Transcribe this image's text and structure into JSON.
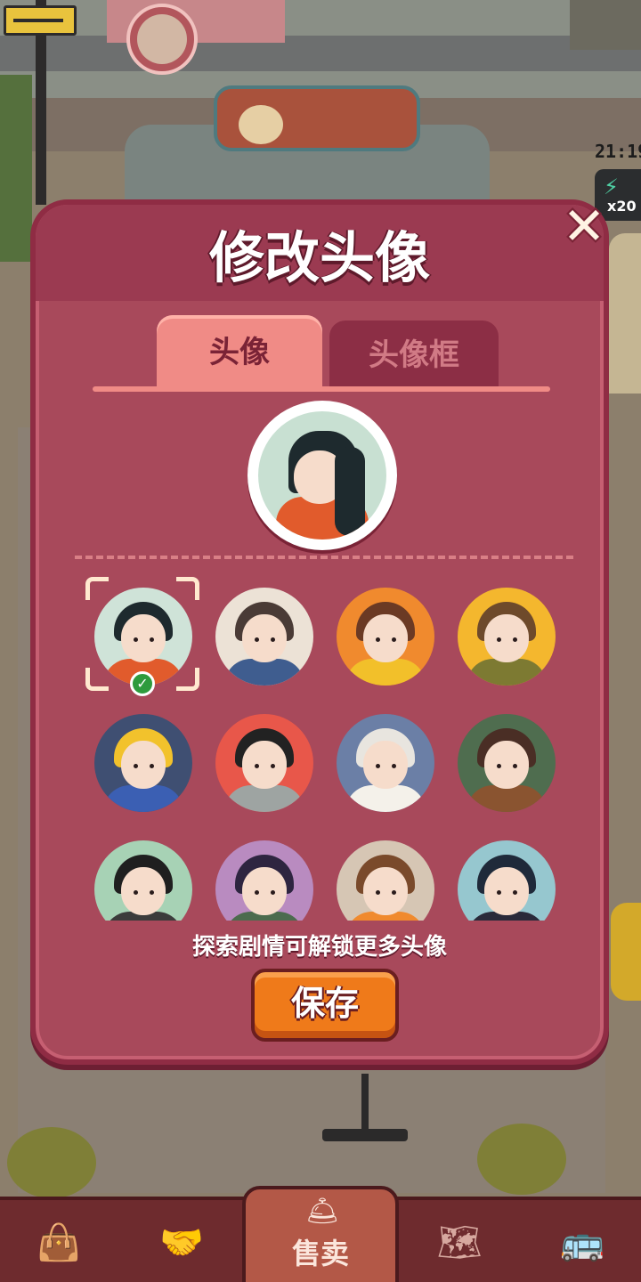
{
  "hud": {
    "clock": "21:19",
    "energy_count": "x20"
  },
  "modal": {
    "title": "修改头像",
    "close_glyph": "✕",
    "tabs": [
      {
        "label": "头像",
        "active": true
      },
      {
        "label": "头像框",
        "active": false
      }
    ],
    "hint": "探索剧情可解锁更多头像",
    "save_label": "保存"
  },
  "avatars": [
    {
      "name": "girl-braid",
      "hair": "#1e2a2e",
      "bg": "#cfe3d8",
      "body": "#e15b2c",
      "selected": true
    },
    {
      "name": "boy-glasses",
      "hair": "#4a3b36",
      "bg": "#ece2d6",
      "body": "#3f5d8f",
      "selected": false
    },
    {
      "name": "girl-brown-hair",
      "hair": "#6b3a24",
      "bg": "#f08a2e",
      "body": "#f2c02a",
      "selected": false
    },
    {
      "name": "girl-short-hair",
      "hair": "#6e4a2b",
      "bg": "#f4b72e",
      "body": "#7d7a32",
      "selected": false
    },
    {
      "name": "boy-hardhat",
      "hair": "#f2c22c",
      "bg": "#3f4f72",
      "body": "#3b5fb3",
      "selected": false
    },
    {
      "name": "woman-bob",
      "hair": "#222222",
      "bg": "#e8574a",
      "body": "#9ea4a2",
      "selected": false
    },
    {
      "name": "old-man",
      "hair": "#e8e5df",
      "bg": "#6b7fa6",
      "body": "#f4f1ea",
      "selected": false
    },
    {
      "name": "man-beret",
      "hair": "#4a2e25",
      "bg": "#4f6d4f",
      "body": "#8a5430",
      "selected": false
    },
    {
      "name": "man-sunglasses",
      "hair": "#1f1f1f",
      "bg": "#a7d2b5",
      "body": "#3b3b3b",
      "selected": false
    },
    {
      "name": "girl-purple",
      "hair": "#2e2540",
      "bg": "#b98bc0",
      "body": "#4c6b4e",
      "selected": false
    },
    {
      "name": "boy-brown",
      "hair": "#7a4a2b",
      "bg": "#d6c6b4",
      "body": "#f08a2e",
      "selected": false
    },
    {
      "name": "woman-long-hair",
      "hair": "#1f2a3a",
      "bg": "#96c7cf",
      "body": "#2a2a3a",
      "selected": false
    }
  ],
  "bottom_nav": {
    "items": [
      {
        "icon": "bag-icon"
      },
      {
        "icon": "handshake-icon"
      },
      {
        "icon": "bell-icon",
        "label": "售卖",
        "active": true
      },
      {
        "icon": "map-icon"
      },
      {
        "icon": "bus-icon"
      }
    ]
  }
}
